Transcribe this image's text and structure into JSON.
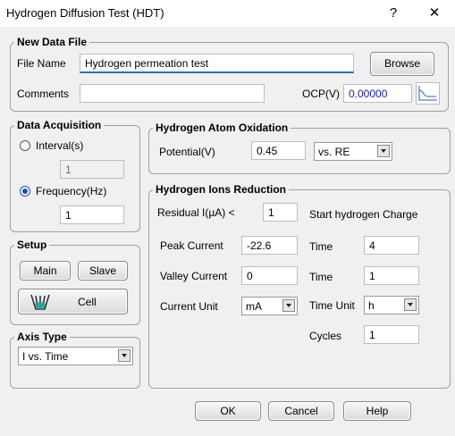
{
  "window": {
    "title": "Hydrogen Diffusion Test (HDT)",
    "help_glyph": "?",
    "close_glyph": "✕"
  },
  "new_data_file": {
    "title": "New Data File",
    "file_name_label": "File Name",
    "file_name_value": "Hydrogen permeation test",
    "browse_label": "Browse",
    "comments_label": "Comments",
    "comments_value": "",
    "ocp_label": "OCP(V)",
    "ocp_value": "0.00000"
  },
  "data_acquisition": {
    "title": "Data Acquisition",
    "interval_label": "Interval(s)",
    "interval_value": "1",
    "frequency_label": "Frequency(Hz)",
    "frequency_value": "1",
    "selected": "frequency"
  },
  "setup": {
    "title": "Setup",
    "main_label": "Main",
    "slave_label": "Slave",
    "cell_label": "Cell"
  },
  "axis_type": {
    "title": "Axis Type",
    "value": "I vs. Time"
  },
  "hydrogen_atom_oxidation": {
    "title": "Hydrogen Atom Oxidation",
    "potential_label": "Potential(V)",
    "potential_value": "0.45",
    "reference_value": "vs. RE"
  },
  "hydrogen_ions_reduction": {
    "title": "Hydrogen Ions Reduction",
    "residual_label": "Residual I(µA) <",
    "residual_value": "1",
    "start_charge_label": "Start hydrogen Charge",
    "peak_current_label": "Peak Current",
    "peak_current_value": "-22.6",
    "time1_label": "Time",
    "time1_value": "4",
    "valley_current_label": "Valley Current",
    "valley_current_value": "0",
    "time2_label": "Time",
    "time2_value": "1",
    "current_unit_label": "Current Unit",
    "current_unit_value": "mA",
    "time_unit_label": "Time Unit",
    "time_unit_value": "h",
    "cycles_label": "Cycles",
    "cycles_value": "1"
  },
  "footer": {
    "ok_label": "OK",
    "cancel_label": "Cancel",
    "help_label": "Help"
  },
  "colors": {
    "accent": "#1a4fbf",
    "focus_underline": "#2b6cc4",
    "ocp_text": "#1a1ab0"
  }
}
